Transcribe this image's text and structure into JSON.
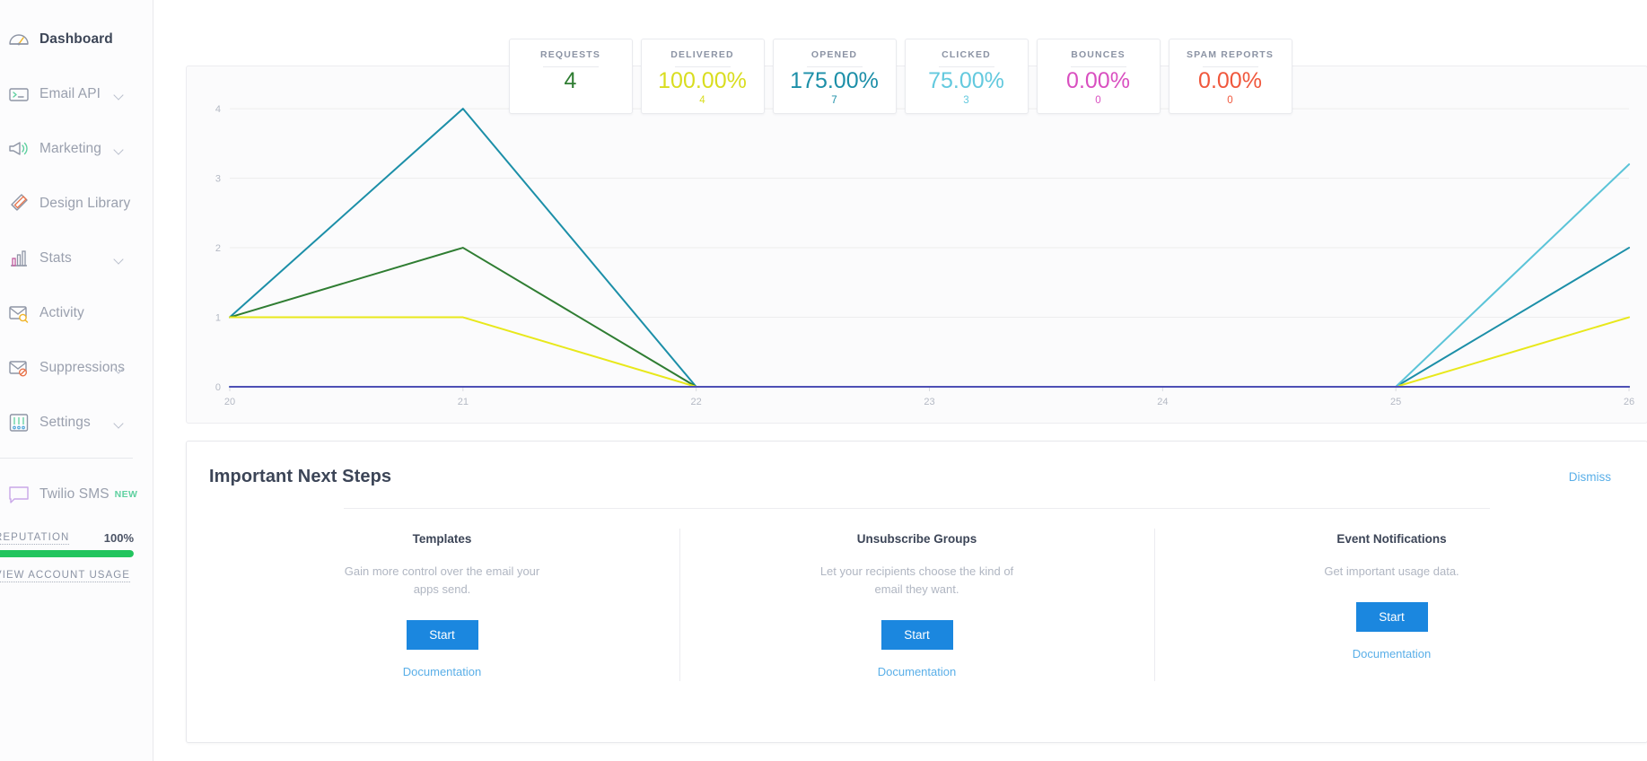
{
  "sidebar": {
    "items": [
      {
        "label": "Dashboard",
        "icon": "gauge-icon",
        "active": true,
        "caret": false
      },
      {
        "label": "Email API",
        "icon": "terminal-icon",
        "active": false,
        "caret": true
      },
      {
        "label": "Marketing",
        "icon": "megaphone-icon",
        "active": false,
        "caret": true
      },
      {
        "label": "Design Library",
        "icon": "pencil-ruler-icon",
        "active": false,
        "caret": false
      },
      {
        "label": "Stats",
        "icon": "bar-chart-icon",
        "active": false,
        "caret": true
      },
      {
        "label": "Activity",
        "icon": "envelope-search-icon",
        "active": false,
        "caret": false
      },
      {
        "label": "Suppressions",
        "icon": "envelope-block-icon",
        "active": false,
        "caret": true
      },
      {
        "label": "Settings",
        "icon": "sliders-icon",
        "active": false,
        "caret": true
      }
    ],
    "twilio": {
      "label": "Twilio SMS",
      "badge": "NEW",
      "icon": "chat-bubble-icon"
    },
    "reputation": {
      "label": "REPUTATION",
      "percent_text": "100%",
      "percent_value": 100,
      "bar_color": "#22c55e"
    },
    "account_usage_link": "VIEW ACCOUNT USAGE"
  },
  "stats": [
    {
      "title": "REQUESTS",
      "value": "4",
      "sub": "",
      "color": "#2f7d32"
    },
    {
      "title": "DELIVERED",
      "value": "100.00%",
      "sub": "4",
      "color": "#d9dd1f"
    },
    {
      "title": "OPENED",
      "value": "175.00%",
      "sub": "7",
      "color": "#1c8fa8"
    },
    {
      "title": "CLICKED",
      "value": "75.00%",
      "sub": "3",
      "color": "#63c9de"
    },
    {
      "title": "BOUNCES",
      "value": "0.00%",
      "sub": "0",
      "color": "#d94fc0"
    },
    {
      "title": "SPAM REPORTS",
      "value": "0.00%",
      "sub": "0",
      "color": "#f0573c"
    }
  ],
  "chart_data": {
    "type": "line",
    "title": "",
    "xlabel": "",
    "ylabel": "",
    "x": [
      20,
      21,
      22,
      23,
      24,
      25,
      26
    ],
    "xtick_labels": [
      "20",
      "21",
      "22",
      "23",
      "24",
      "25",
      "26"
    ],
    "ytick_labels": [
      "0",
      "1",
      "2",
      "3",
      "4"
    ],
    "yticks": [
      0,
      1,
      2,
      3,
      4
    ],
    "ylim": [
      0,
      4.35
    ],
    "grid": true,
    "legend": "none",
    "series": [
      {
        "name": "Opened",
        "color": "#1c8fa8",
        "values": [
          1,
          4,
          0,
          0,
          0,
          0,
          2
        ]
      },
      {
        "name": "Requests",
        "color": "#2f7d32",
        "values": [
          1,
          2,
          0,
          0,
          0,
          0,
          0
        ]
      },
      {
        "name": "Delivered",
        "color": "#e8e81b",
        "values": [
          1,
          1,
          0,
          0,
          0,
          0,
          1
        ]
      },
      {
        "name": "Clicked",
        "color": "#5bc4d8",
        "values": [
          0,
          0,
          0,
          0,
          0,
          0,
          3.2
        ]
      },
      {
        "name": "Bounces",
        "color": "#4d4fb5",
        "values": [
          0,
          0,
          0,
          0,
          0,
          0,
          0
        ]
      }
    ]
  },
  "next_steps": {
    "title": "Important Next Steps",
    "dismiss_label": "Dismiss",
    "columns": [
      {
        "title": "Templates",
        "description": "Gain more control over the email your apps send.",
        "button_label": "Start",
        "doc_label": "Documentation"
      },
      {
        "title": "Unsubscribe Groups",
        "description": "Let your recipients choose the kind of email they want.",
        "button_label": "Start",
        "doc_label": "Documentation"
      },
      {
        "title": "Event Notifications",
        "description": "Get important usage data.",
        "button_label": "Start",
        "doc_label": "Documentation"
      }
    ]
  }
}
